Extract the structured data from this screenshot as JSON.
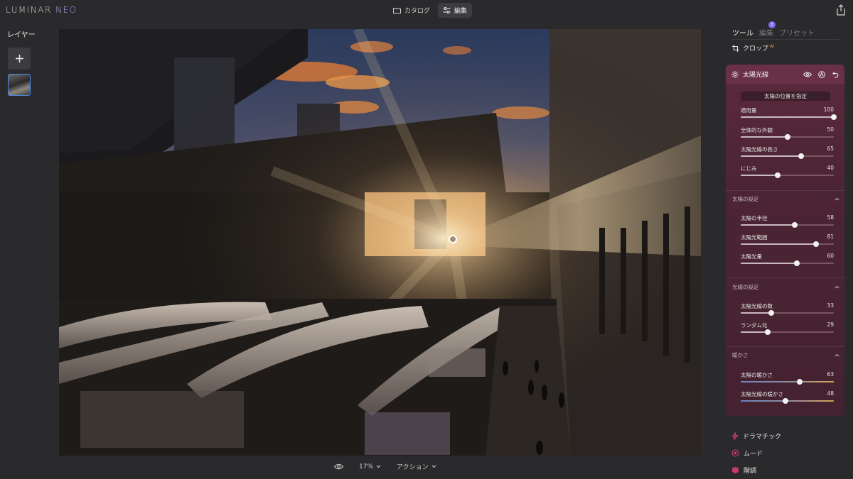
{
  "app": {
    "logo_main": "LUMINAR",
    "logo_accent": "NEO"
  },
  "top_tabs": [
    {
      "label": "カタログ",
      "icon": "folder-icon",
      "active": false
    },
    {
      "label": "編集",
      "icon": "sliders-icon",
      "active": true
    }
  ],
  "left_panel": {
    "title": "レイヤー",
    "add_icon": "plus-icon"
  },
  "bottom_bar": {
    "zoom": "17%",
    "actions": "アクション"
  },
  "right_panel": {
    "tabs": [
      {
        "label": "ツール",
        "active": true
      },
      {
        "label": "編集",
        "active": false,
        "badge": "7"
      },
      {
        "label": "プリセット",
        "active": false
      }
    ],
    "crop": {
      "label": "クロップ",
      "ai_tag": "AI"
    },
    "tool": {
      "name": "太陽光線",
      "place_sun_button": "太陽の位置を指定",
      "main_sliders": [
        {
          "label": "適用量",
          "value": "100",
          "fraction": 1.0
        },
        {
          "label": "全体的な外観",
          "value": "50",
          "fraction": 0.5
        },
        {
          "label": "太陽光線の長さ",
          "value": "65",
          "fraction": 0.65
        },
        {
          "label": "にじみ",
          "value": "40",
          "fraction": 0.4
        }
      ],
      "sections": [
        {
          "title": "太陽の設定",
          "sliders": [
            {
              "label": "太陽の半径",
              "value": "58",
              "fraction": 0.58
            },
            {
              "label": "太陽光範囲",
              "value": "81",
              "fraction": 0.81
            },
            {
              "label": "太陽光量",
              "value": "60",
              "fraction": 0.6
            }
          ]
        },
        {
          "title": "光線の設定",
          "sliders": [
            {
              "label": "太陽光線の数",
              "value": "33",
              "fraction": 0.33
            },
            {
              "label": "ランダム化",
              "value": "29",
              "fraction": 0.29
            }
          ]
        },
        {
          "title": "暖かさ",
          "sliders": [
            {
              "label": "太陽の暖かさ",
              "value": "63",
              "fraction": 0.63
            },
            {
              "label": "太陽光線の暖かさ",
              "value": "48",
              "fraction": 0.48
            }
          ]
        }
      ]
    },
    "bottom_tools": [
      {
        "label": "ドラマチック",
        "icon": "lightning-icon"
      },
      {
        "label": "ムード",
        "icon": "mood-icon"
      },
      {
        "label": "階調",
        "icon": "tone-icon"
      }
    ]
  },
  "colors": {
    "accent": "#7b6cf0",
    "tool_panel": "#5b2a3d",
    "icon_pink": "#e0407a",
    "selection_blue": "#4a8cf0"
  }
}
